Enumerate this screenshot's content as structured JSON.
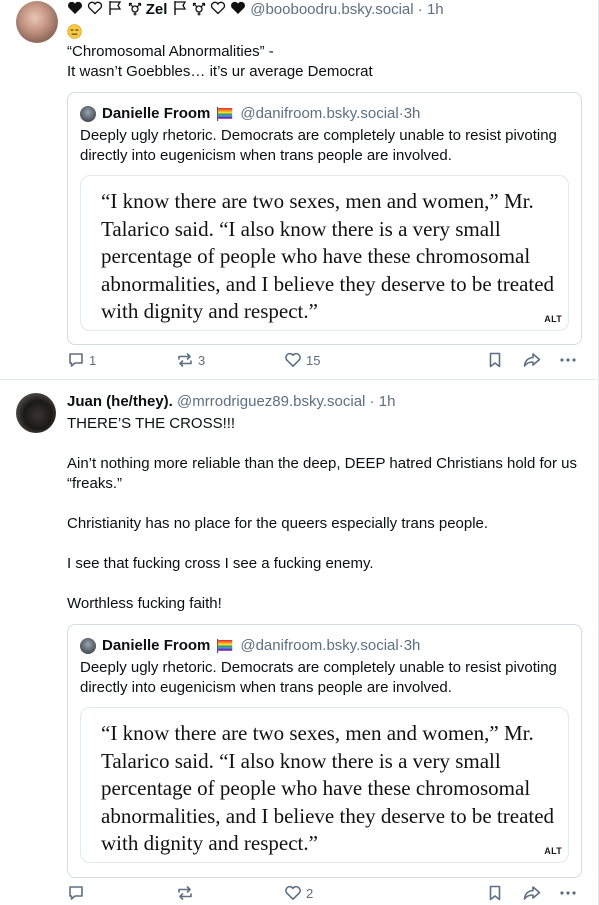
{
  "posts": [
    {
      "display_name": "Zel",
      "handle": "@booboodru.bsky.social",
      "time": "1h",
      "emoji": "😑",
      "text": "“Chromosomal Abnormalities” -\nIt wasn’t Goebbles… it’s ur average Democrat",
      "quote": {
        "name": "Danielle Froom",
        "handle": "@danifroom.bsky.social",
        "time": "3h",
        "text": "Deeply ugly rhetoric. Democrats are completely unable to resist pivoting directly into eugenicism when trans people are involved.",
        "image_text": "“I know there are two sexes, men and women,” Mr. Talarico said. “I also know there is a very small percentage of people who have these chromosomal abnormalities, and I believe they deserve to be treated with dignity and respect.”",
        "alt_badge": "ALT"
      },
      "counts": {
        "replies": "1",
        "reposts": "3",
        "likes": "15"
      }
    },
    {
      "display_name": "Juan (he/they).",
      "handle": "@mrrodriguez89.bsky.social",
      "time": "1h",
      "text": "THERE’S THE CROSS!!!\n\nAin’t nothing more reliable than the deep, DEEP hatred Christians hold for us “freaks.”\n\nChristianity has no place for the queers especially trans people.\n\nI see that fucking cross I see a fucking enemy.\n\nWorthless fucking faith!",
      "quote": {
        "name": "Danielle Froom",
        "handle": "@danifroom.bsky.social",
        "time": "3h",
        "text": "Deeply ugly rhetoric. Democrats are completely unable to resist pivoting directly into eugenicism when trans people are involved.",
        "image_text": "“I know there are two sexes, men and women,” Mr. Talarico said. “I also know there is a very small percentage of people who have these chromosomal abnormalities, and I believe they deserve to be treated with dignity and respect.”",
        "alt_badge": "ALT"
      },
      "counts": {
        "replies": "",
        "reposts": "",
        "likes": "2"
      }
    }
  ],
  "ui": {
    "separator": " · "
  },
  "colors": {
    "text": "#0b0f14",
    "muted": "#5d6f82",
    "border": "#d4dbe2"
  },
  "icons": [
    "black-heart-icon",
    "white-heart-icon",
    "white-flag-icon",
    "transgender-symbol-icon",
    "transgender-flag-icon",
    "expressionless-face-emoji",
    "rainbow-flag-icon",
    "reply-icon",
    "repost-icon",
    "like-icon",
    "bookmark-icon",
    "share-icon",
    "more-icon"
  ]
}
